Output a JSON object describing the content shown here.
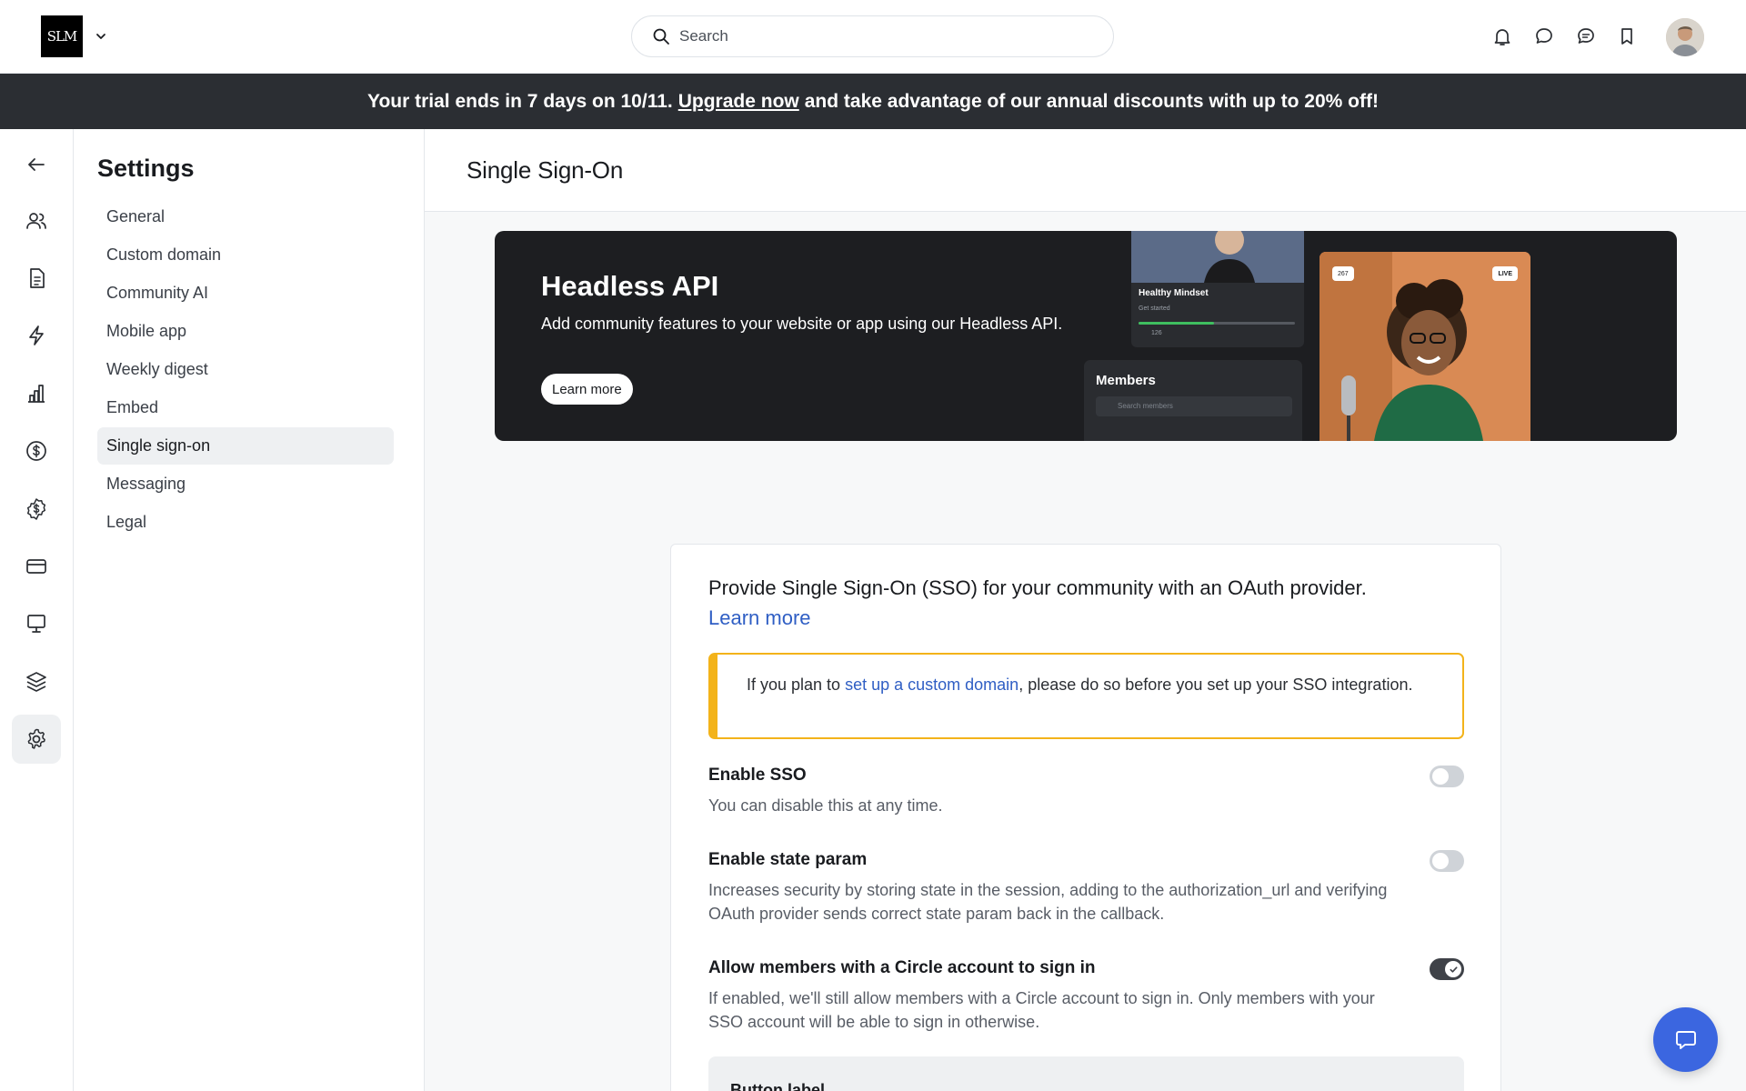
{
  "brand": {
    "logo_text": "SLM"
  },
  "search": {
    "placeholder": "Search"
  },
  "header_icons": [
    "bell-icon",
    "chat-bubble-icon",
    "messages-icon",
    "bookmark-icon"
  ],
  "trial_banner": {
    "prefix": "Your trial ends in 7 days on 10/11.",
    "link": "Upgrade now",
    "suffix": "and take advantage of our annual discounts with up to 20% off!"
  },
  "rail": {
    "items": [
      "back-arrow-icon",
      "members-icon",
      "posts-icon",
      "workflows-icon",
      "analytics-icon",
      "paywalls-icon",
      "affiliates-icon",
      "billing-icon",
      "site-icon",
      "plans-icon",
      "settings-icon"
    ],
    "active": "settings-icon"
  },
  "sidebar": {
    "title": "Settings",
    "items": [
      {
        "label": "General"
      },
      {
        "label": "Custom domain"
      },
      {
        "label": "Community AI"
      },
      {
        "label": "Mobile app"
      },
      {
        "label": "Weekly digest"
      },
      {
        "label": "Embed"
      },
      {
        "label": "Single sign-on",
        "active": true
      },
      {
        "label": "Messaging"
      },
      {
        "label": "Legal"
      }
    ]
  },
  "page": {
    "title": "Single Sign-On"
  },
  "promo": {
    "title": "Headless API",
    "description": "Add community features to your website or app using our Headless API.",
    "button": "Learn more",
    "mock": {
      "card_title": "Healthy Mindset",
      "card_sub": "Get started",
      "card_count": "126",
      "members_title": "Members",
      "members_search": "Search members",
      "viewer_count": "267",
      "live_badge": "LIVE"
    }
  },
  "sso": {
    "intro": "Provide Single Sign-On (SSO) for your community with an OAuth provider.",
    "intro_link": "Learn more",
    "callout_prefix": "If you plan to",
    "callout_link": "set up a custom domain",
    "callout_suffix": ", please do so before you set up your SSO integration.",
    "settings": [
      {
        "title": "Enable SSO",
        "description": "You can disable this at any time.",
        "enabled": false
      },
      {
        "title": "Enable state param",
        "description": "Increases security by storing state in the session, adding to the authorization_url and verifying OAuth provider sends correct state param back in the callback.",
        "enabled": false
      },
      {
        "title": "Allow members with a Circle account to sign in",
        "description": "If enabled, we'll still allow members with a Circle account to sign in. Only members with your SSO account will be able to sign in otherwise.",
        "enabled": true
      }
    ],
    "subpanel_label": "Button label"
  },
  "colors": {
    "accent": "#3b66e0",
    "link": "#2f5ec4",
    "callout_border": "#f3b31a",
    "banner_bg": "#2b2e33"
  }
}
